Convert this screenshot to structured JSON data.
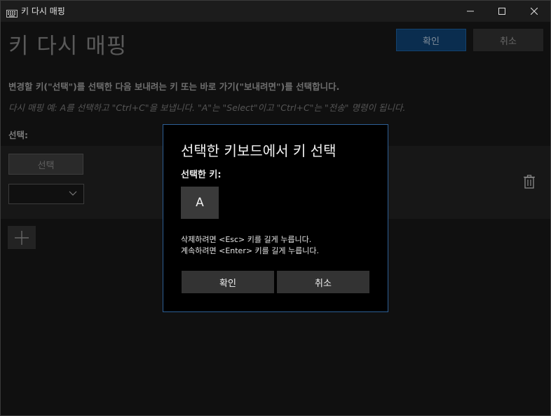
{
  "window": {
    "title": "키 다시 매핑",
    "icon": "keyboard-icon",
    "controls": [
      "minimize-icon",
      "maximize-icon",
      "close-icon"
    ]
  },
  "page": {
    "title": "키 다시 매핑",
    "ok_label": "확인",
    "cancel_label": "취소",
    "instruction": "변경할 키(\"선택\")를 선택한 다음 보내려는 키 또는 바로 가기(\"보내려면\")를 선택합니다.",
    "example": "다시 매핑 예: A를 선택하고 \"Ctrl+C\"을 보냅니다. \"A\"는 \"Select\"이고 \"Ctrl+C\"는 \"전송\" 명령이 됩니다.",
    "select_header": "선택:",
    "row": {
      "select_button_label": "선택",
      "combo_value": "",
      "delete_icon": "trash-icon"
    },
    "add_icon": "plus-icon"
  },
  "dialog": {
    "title": "선택한 키보드에서 키 선택",
    "selected_key_label": "선택한 키:",
    "selected_key": "A",
    "help_line1": "삭제하려면 <Esc> 키를 길게 누릅니다.",
    "help_line2": "계속하려면 <Enter> 키를 길게 누릅니다.",
    "ok_label": "확인",
    "cancel_label": "취소"
  },
  "colors": {
    "background": "#101010",
    "accent_border": "#2d5f95",
    "primary_button": "#0a2d4f"
  }
}
